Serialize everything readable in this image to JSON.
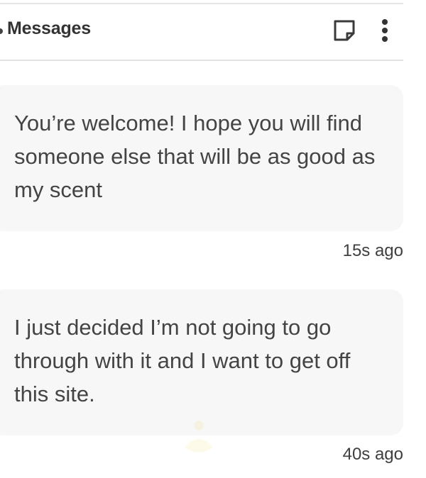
{
  "header": {
    "title": "Messages",
    "note_icon": "note-icon",
    "menu_icon": "more-vertical-icon"
  },
  "messages": [
    {
      "text": "You’re welcome! I hope you will find someone else that will be as good as my scent",
      "time": "15s ago"
    },
    {
      "text": "I just decided I’m not going to go through with it and I want to get off this site.",
      "time": "40s ago"
    }
  ],
  "colors": {
    "bubble_bg": "#f7f7f8",
    "divider": "#e3e3e3",
    "text": "#444444"
  }
}
